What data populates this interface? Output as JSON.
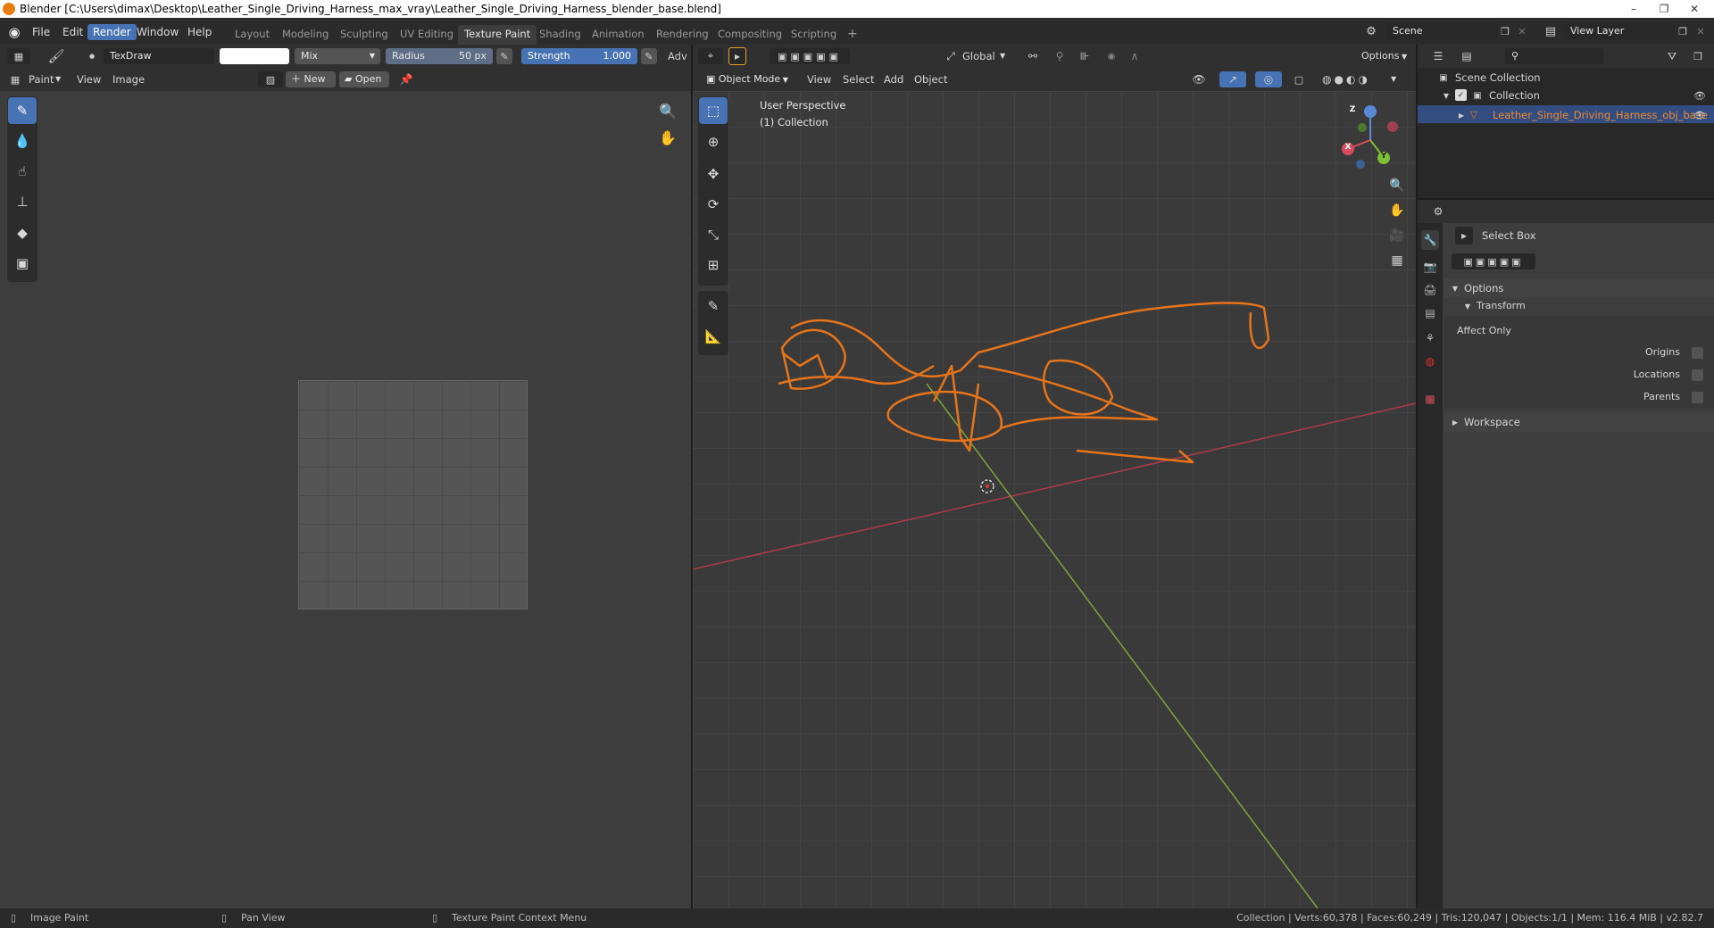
{
  "window": {
    "title": "Blender [C:\\Users\\dimax\\Desktop\\Leather_Single_Driving_Harness_max_vray\\Leather_Single_Driving_Harness_blender_base.blend]",
    "controls": [
      "–",
      "❐",
      "✕"
    ]
  },
  "menu": {
    "items": [
      "File",
      "Edit",
      "Render",
      "Window",
      "Help"
    ],
    "active": "Render"
  },
  "workspaces": {
    "tabs": [
      "Layout",
      "Modeling",
      "Sculpting",
      "UV Editing",
      "Texture Paint",
      "Shading",
      "Animation",
      "Rendering",
      "Compositing",
      "Scripting"
    ],
    "active": "Texture Paint",
    "add": "+"
  },
  "scene": {
    "name": "Scene",
    "view_layer": "View Layer"
  },
  "paint_header": {
    "brush": "TexDraw",
    "blend": "Mix",
    "radius_label": "Radius",
    "radius_value": "50 px",
    "strength_label": "Strength",
    "strength_value": "1.000",
    "advanced": "Adv",
    "color": "#ffffff"
  },
  "image_editor": {
    "mode": "Paint",
    "menus": [
      "View",
      "Image"
    ],
    "new_label": "New",
    "open_label": "Open"
  },
  "viewport_header": {
    "orientation": "Global",
    "options": "Options",
    "mode": "Object Mode",
    "menus": [
      "View",
      "Select",
      "Add",
      "Object"
    ]
  },
  "viewport": {
    "perspective": "User Perspective",
    "collection": "(1) Collection",
    "axes": [
      "X",
      "Y",
      "Z"
    ],
    "object_color": "#e8741a"
  },
  "outliner": {
    "root": "Scene Collection",
    "collection": "Collection",
    "object": "Leather_Single_Driving_Harness_obj_base"
  },
  "properties": {
    "tool": "Select Box",
    "options_panel": "Options",
    "transform_panel": "Transform",
    "affect_only": "Affect Only",
    "checks": [
      "Origins",
      "Locations",
      "Parents"
    ],
    "workspace_panel": "Workspace"
  },
  "statusbar": {
    "left": "Image Paint",
    "middle": "Pan View",
    "right_menu": "Texture Paint Context Menu",
    "stats": "Collection | Verts:60,378 | Faces:60,249 | Tris:120,047 | Objects:1/1 | Mem: 116.4 MiB | v2.82.7"
  }
}
